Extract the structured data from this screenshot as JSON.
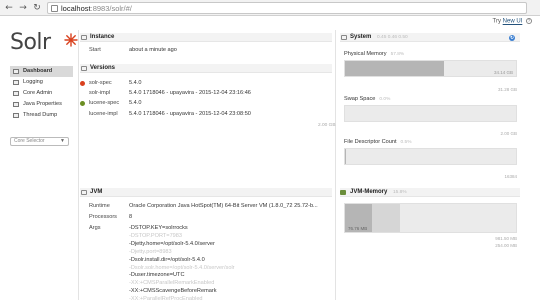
{
  "browser": {
    "url_host": "localhost",
    "url_rest": ":8983/solr/#/"
  },
  "topbar": {
    "try_text": "Try",
    "new_ui_link": "New UI",
    "help_glyph": "?"
  },
  "logo": {
    "text": "Solr"
  },
  "sidebar": {
    "items": [
      {
        "label": "Dashboard",
        "icon": "dashboard-icon",
        "active": true
      },
      {
        "label": "Logging",
        "icon": "logging-icon"
      },
      {
        "label": "Core Admin",
        "icon": "core-admin-icon"
      },
      {
        "label": "Java Properties",
        "icon": "java-properties-icon"
      },
      {
        "label": "Thread Dump",
        "icon": "thread-dump-icon"
      }
    ],
    "core_selector": "Core Selector"
  },
  "instance": {
    "title": "Instance",
    "start_label": "Start",
    "start_value": "about a minute ago"
  },
  "versions": {
    "title": "Versions",
    "rows": [
      {
        "label": "solr-spec",
        "value": "5.4.0"
      },
      {
        "label": "solr-impl",
        "value": "5.4.0 1718046 - upayavira - 2015-12-04 23:16:46"
      },
      {
        "label": "lucene-spec",
        "value": "5.4.0"
      },
      {
        "label": "lucene-impl",
        "value": "5.4.0 1718046 - upayavira - 2015-12-04 23:08:50"
      }
    ]
  },
  "jvm": {
    "title": "JVM",
    "runtime_label": "Runtime",
    "runtime_value": "Oracle Corporation Java HotSpot(TM) 64-Bit Server VM (1.8.0_72 25.72-b...",
    "processors_label": "Processors",
    "processors_value": "8",
    "args_label": "Args",
    "args": [
      {
        "text": "-DSTOP.KEY=solrrocks",
        "faded": false
      },
      {
        "text": "-DSTOP.PORT=7983",
        "faded": true
      },
      {
        "text": "-Djetty.home=/opt/solr-5.4.0/server",
        "faded": false
      },
      {
        "text": "-Djetty.port=8983",
        "faded": true
      },
      {
        "text": "-Dsolr.install.dir=/opt/solr-5.4.0",
        "faded": false
      },
      {
        "text": "-Dsolr.solr.home=/opt/solr-5.4.0/server/solr",
        "faded": true
      },
      {
        "text": "-Duser.timezone=UTC",
        "faded": false
      },
      {
        "text": "-XX:+CMSParallelRemarkEnabled",
        "faded": true
      },
      {
        "text": "-XX:+CMSScavengeBeforeRemark",
        "faded": false
      },
      {
        "text": "-XX:+ParallelRefProcEnabled",
        "faded": true
      }
    ]
  },
  "system": {
    "title": "System",
    "load": "0.45 0.46 0.50",
    "physical_memory": {
      "label": "Physical Memory",
      "percent": "57.8%",
      "fill": 0.578,
      "used": "34.14 GB",
      "total": "31.28 GB"
    },
    "swap_space": {
      "label": "Swap Space",
      "percent": "0.0%",
      "fill": 0.0,
      "total": "2.00 GB"
    },
    "file_descriptors": {
      "label": "File Descriptor Count",
      "percent": "0.5%",
      "fill": 0.005,
      "total": "16384"
    },
    "colors": {
      "fill_dark": "#b5b5b5",
      "fill_light": "#d6d6d6",
      "track": "#ebebeb"
    }
  },
  "jvm_memory": {
    "title": "JVM-Memory",
    "percent": "15.8%",
    "used": "76.76 MB",
    "fill_used": 0.158,
    "fill_committed": 0.32,
    "total": "981.50 MB",
    "committed": "254.00 MB"
  }
}
